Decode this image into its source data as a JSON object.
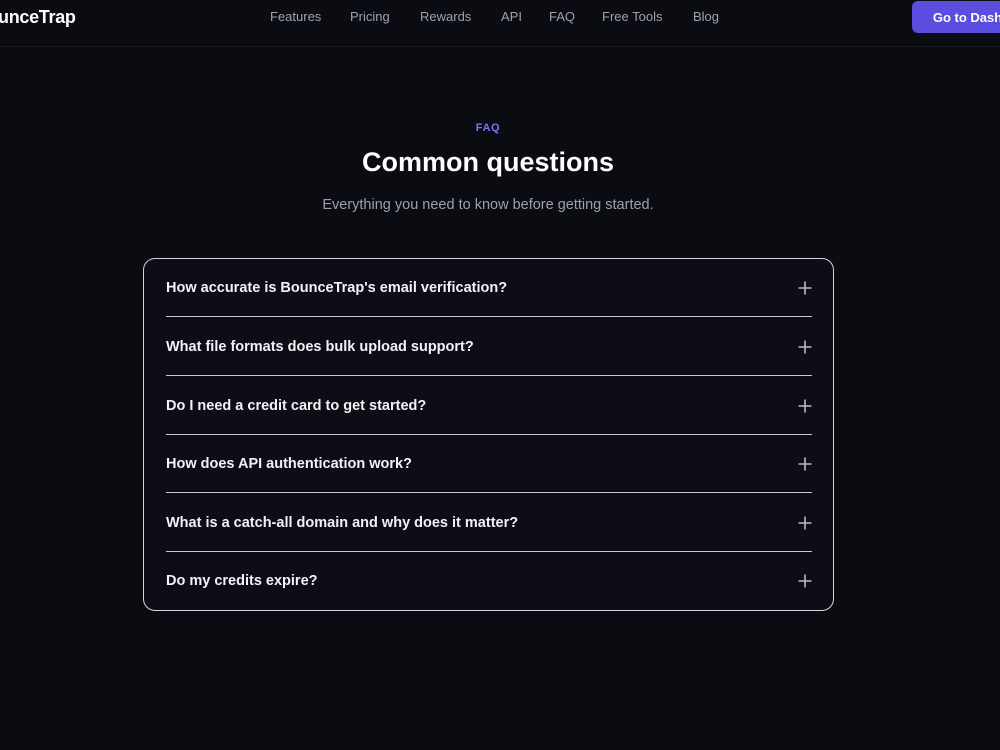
{
  "header": {
    "logo": "unceTrap",
    "nav": [
      "Features",
      "Pricing",
      "Rewards",
      "API",
      "FAQ",
      "Free Tools",
      "Blog"
    ],
    "cta_label": "Go to Dashb"
  },
  "faq_section": {
    "eyebrow": "FAQ",
    "title": "Common questions",
    "subtitle": "Everything you need to know before getting started.",
    "items": [
      {
        "question": "How accurate is BounceTrap's email verification?",
        "icon": "plus-icon"
      },
      {
        "question": "What file formats does bulk upload support?",
        "icon": "plus-icon"
      },
      {
        "question": "Do I need a credit card to get started?",
        "icon": "plus-icon"
      },
      {
        "question": "How does API authentication work?",
        "icon": "plus-icon"
      },
      {
        "question": "What is a catch-all domain and why does it matter?",
        "icon": "plus-icon"
      },
      {
        "question": "Do my credits expire?",
        "icon": "plus-icon"
      }
    ]
  },
  "colors": {
    "background": "#0b0b12",
    "accent": "#5b4de0",
    "eyebrow": "#7c74f0"
  }
}
